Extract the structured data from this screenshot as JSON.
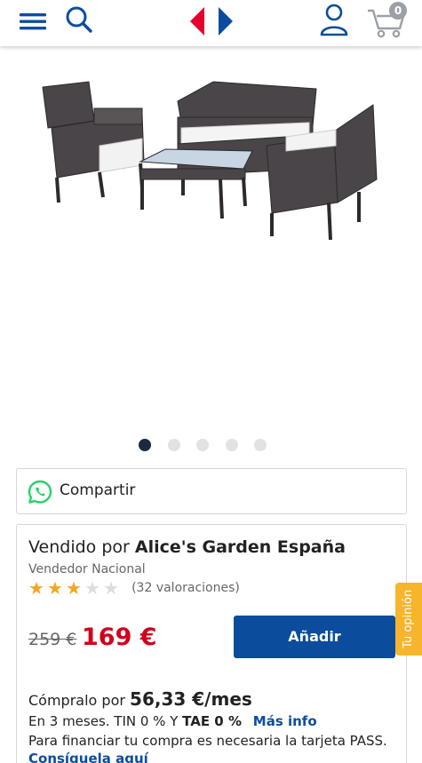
{
  "header": {
    "cart_count": "0",
    "icons": [
      "menu-icon",
      "search-icon",
      "carrefour-logo",
      "user-icon",
      "cart-icon"
    ],
    "brand_colors": {
      "red": "#e4002b",
      "blue": "#0b4d9c"
    }
  },
  "gallery": {
    "slides": 5,
    "active_index": 0
  },
  "share": {
    "label": "Compartir",
    "icon": "whatsapp-icon"
  },
  "seller": {
    "prefix": "Vendido por",
    "name": "Alice's Garden España",
    "type": "Vendedor Nacional",
    "rating_stars": 3,
    "rating_max": 5,
    "rating_count": "(32 valoraciones)"
  },
  "pricing": {
    "old_price": "259 €",
    "new_price": "169 €",
    "add_button": "Añadir"
  },
  "financing": {
    "prefix": "Cómpralo por",
    "amount": "56,33 €/mes",
    "terms": "En 3 meses. TIN 0 % Y",
    "tae": "TAE 0 %",
    "more_info": "Más info",
    "pass_note": "Para financiar tu compra es necesaria la tarjeta PASS.",
    "get_link": "Consíguela aquí"
  },
  "feedback": {
    "label": "Tu opinión"
  }
}
